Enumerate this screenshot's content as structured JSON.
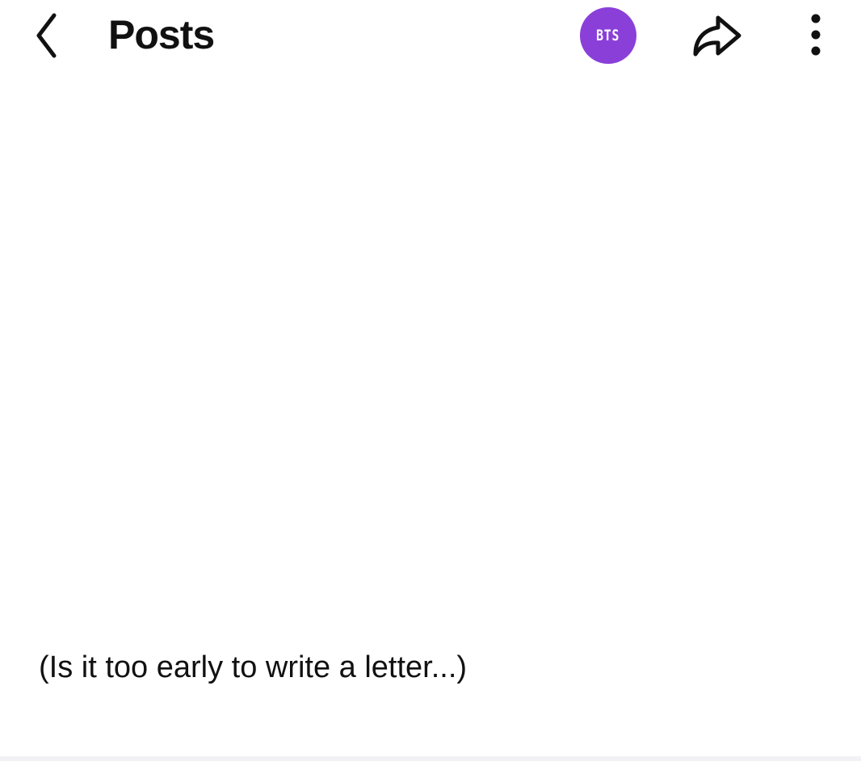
{
  "header": {
    "title": "Posts",
    "avatar_label": "BTS",
    "avatar_color": "#8b3fd9"
  },
  "icons": {
    "back": "chevron-left-icon",
    "share": "share-arrow-icon",
    "more": "vertical-dots-icon"
  },
  "post": {
    "text": "(Is it too early to write a letter...)"
  }
}
